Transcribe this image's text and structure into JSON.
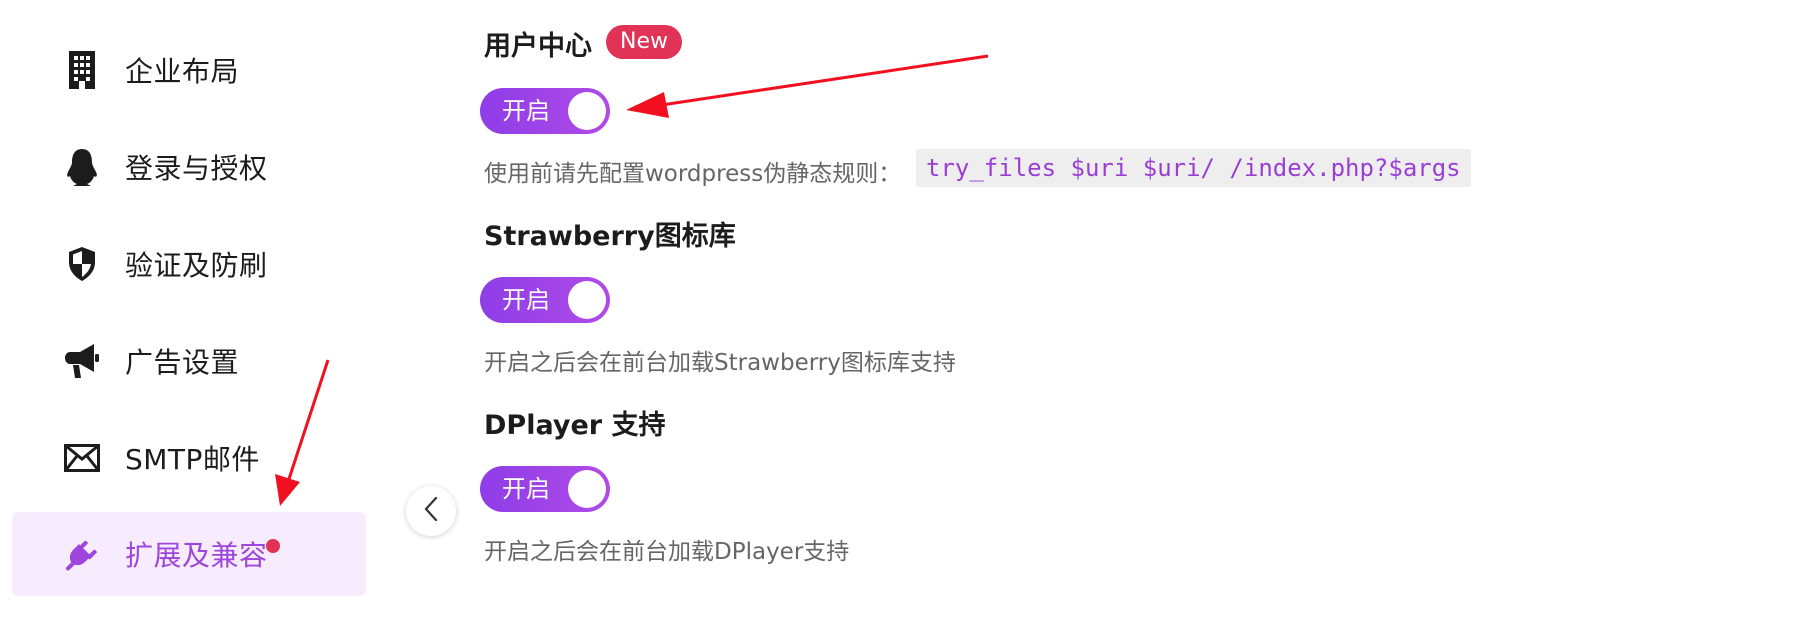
{
  "sidebar": {
    "items": [
      {
        "label": "企业布局",
        "icon": "building-icon",
        "active": false
      },
      {
        "label": "登录与授权",
        "icon": "penguin-icon",
        "active": false
      },
      {
        "label": "验证及防刷",
        "icon": "shield-icon",
        "active": false
      },
      {
        "label": "广告设置",
        "icon": "megaphone-icon",
        "active": false
      },
      {
        "label": "SMTP邮件",
        "icon": "envelope-icon",
        "active": false
      },
      {
        "label": "扩展及兼容",
        "icon": "plug-icon",
        "active": true,
        "has_notification_dot": true
      }
    ],
    "collapse_icon": "chevron-left-icon"
  },
  "sections": {
    "user_center": {
      "title": "用户中心",
      "badge": "New",
      "toggle_label": "开启",
      "toggle_on": true,
      "description": "使用前请先配置wordpress伪静态规则：",
      "code": "try_files $uri $uri/ /index.php?$args"
    },
    "strawberry": {
      "title": "Strawberry图标库",
      "toggle_label": "开启",
      "toggle_on": true,
      "description": "开启之后会在前台加载Strawberry图标库支持"
    },
    "dplayer": {
      "title": "DPlayer 支持",
      "toggle_label": "开启",
      "toggle_on": true,
      "description": "开启之后会在前台加载DPlayer支持"
    }
  },
  "colors": {
    "accent": "#9e45db",
    "toggle_gradient_start": "#8e3de8",
    "toggle_gradient_end": "#b04be8",
    "badge": "#e03355",
    "active_bg": "#f6ecfd",
    "annotation_arrow": "#f01020"
  }
}
